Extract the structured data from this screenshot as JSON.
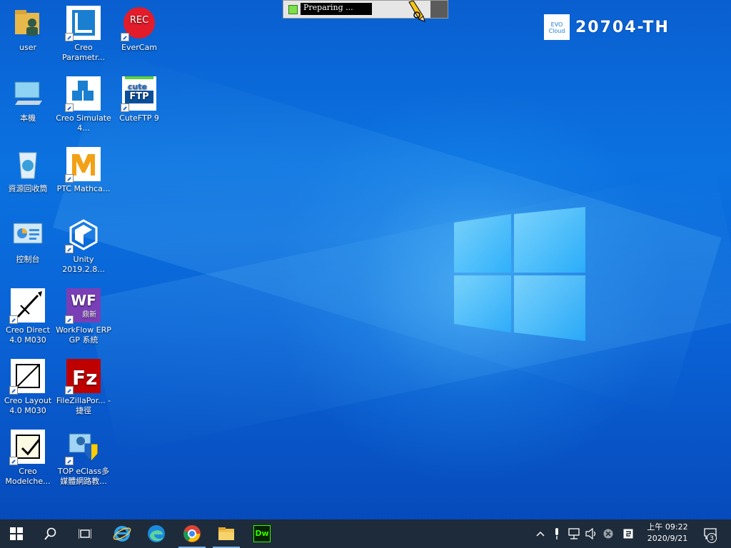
{
  "desktop": {
    "icons": [
      {
        "label": "user",
        "icon": "user-folder-icon"
      },
      {
        "label": "Creo Parametr...",
        "icon": "creo-parametric-icon"
      },
      {
        "label": "EverCam",
        "icon": "evercam-icon",
        "badge": "REC"
      },
      {
        "label": "本機",
        "icon": "this-pc-icon"
      },
      {
        "label": "Creo Simulate 4...",
        "icon": "creo-simulate-icon"
      },
      {
        "label": "CuteFTP 9",
        "icon": "cuteftp-icon",
        "badge_top": "cute",
        "badge_bottom": "FTP"
      },
      {
        "label": "資源回收筒",
        "icon": "recycle-bin-icon"
      },
      {
        "label": "PTC Mathca...",
        "icon": "ptc-mathcad-icon"
      },
      {
        "label": "控制台",
        "icon": "control-panel-icon"
      },
      {
        "label": "Unity 2019.2.8...",
        "icon": "unity-icon"
      },
      {
        "label": "Creo Direct 4.0 M030",
        "icon": "creo-direct-icon"
      },
      {
        "label": "WorkFlow ERP GP 系統",
        "icon": "workflow-erp-icon",
        "badge": "WF",
        "sub_badge": "鼎新"
      },
      {
        "label": "Creo Layout 4.0 M030",
        "icon": "creo-layout-icon"
      },
      {
        "label": "FileZillaPor... - 捷徑",
        "icon": "filezilla-icon"
      },
      {
        "label": "Creo Modelche...",
        "icon": "creo-modelcheck-icon"
      },
      {
        "label": "TOP eClass多媒體網路教...",
        "icon": "top-eclass-icon"
      }
    ]
  },
  "overlay": {
    "status": "Preparing ..."
  },
  "branding": {
    "evo_top": "EVO",
    "evo_bottom": "Cloud",
    "hostname": "20704-TH"
  },
  "taskbar": {
    "apps": [
      {
        "name": "start",
        "icon": "windows-start-icon"
      },
      {
        "name": "search",
        "icon": "search-icon"
      },
      {
        "name": "task-view",
        "icon": "task-view-icon"
      },
      {
        "name": "internet-explorer",
        "icon": "internet-explorer-icon"
      },
      {
        "name": "edge",
        "icon": "edge-icon"
      },
      {
        "name": "chrome",
        "icon": "chrome-icon"
      },
      {
        "name": "file-explorer",
        "icon": "file-explorer-icon"
      },
      {
        "name": "dreamweaver",
        "icon": "dreamweaver-icon",
        "label": "Dw"
      }
    ],
    "tray": {
      "time": "上午 09:22",
      "date": "2020/9/21",
      "notifications": "3"
    }
  },
  "colors": {
    "taskbar_bg": "#1e2b3a",
    "desktop_accent": "#0a6fe0"
  }
}
